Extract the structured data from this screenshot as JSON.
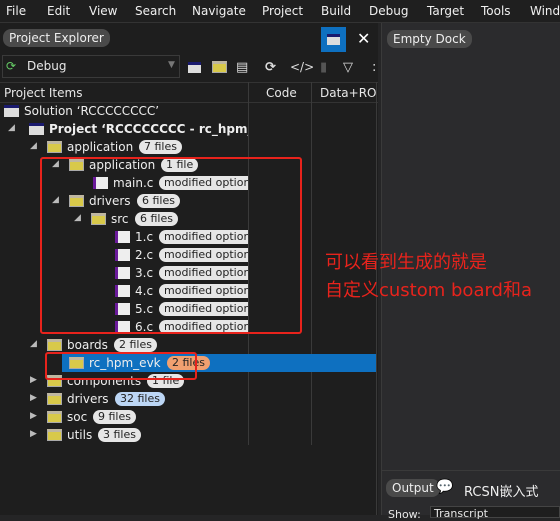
{
  "menu": [
    "File",
    "Edit",
    "View",
    "Search",
    "Navigate",
    "Project",
    "Build",
    "Debug",
    "Target",
    "Tools",
    "Window"
  ],
  "explorer": {
    "title": "Project Explorer",
    "config": "Debug"
  },
  "columns": {
    "items": "Project Items",
    "code": "Code",
    "data": "Data+RO"
  },
  "tree": [
    {
      "label": "Solution ‘RCCCCCCCC’",
      "depth": 0,
      "type": "solution",
      "arrow": ""
    },
    {
      "label": "Project ‘RCCCCCCCC - rc_hpm_evk’",
      "depth": 1,
      "type": "project",
      "arrow": "open",
      "bold": true
    },
    {
      "label": "application",
      "depth": 2,
      "type": "folder",
      "arrow": "open",
      "badge": "7 files"
    },
    {
      "label": "application",
      "depth": 3,
      "type": "folder",
      "arrow": "open",
      "badge": "1 file"
    },
    {
      "label": "main.c",
      "depth": 4,
      "type": "file",
      "badge": "modified options"
    },
    {
      "label": "drivers",
      "depth": 3,
      "type": "folder",
      "arrow": "open",
      "badge": "6 files"
    },
    {
      "label": "src",
      "depth": 4,
      "type": "folder",
      "arrow": "open",
      "badge": "6 files"
    },
    {
      "label": "1.c",
      "depth": 5,
      "type": "file",
      "badge": "modified options"
    },
    {
      "label": "2.c",
      "depth": 5,
      "type": "file",
      "badge": "modified options"
    },
    {
      "label": "3.c",
      "depth": 5,
      "type": "file",
      "badge": "modified options"
    },
    {
      "label": "4.c",
      "depth": 5,
      "type": "file",
      "badge": "modified options"
    },
    {
      "label": "5.c",
      "depth": 5,
      "type": "file",
      "badge": "modified options"
    },
    {
      "label": "6.c",
      "depth": 5,
      "type": "file",
      "badge": "modified options"
    },
    {
      "label": "boards",
      "depth": 2,
      "type": "folder",
      "arrow": "open",
      "badge": "2 files"
    },
    {
      "label": "rc_hpm_evk",
      "depth": 3,
      "type": "folder",
      "arrow": "closed",
      "badge": "2 files",
      "badge_color": "orange",
      "selected": true
    },
    {
      "label": "components",
      "depth": 2,
      "type": "folder",
      "arrow": "closed",
      "badge": "1 file"
    },
    {
      "label": "drivers",
      "depth": 2,
      "type": "folder",
      "arrow": "closed",
      "badge": "32 files",
      "badge_color": "blue"
    },
    {
      "label": "soc",
      "depth": 2,
      "type": "folder",
      "arrow": "closed",
      "badge": "9 files"
    },
    {
      "label": "utils",
      "depth": 2,
      "type": "folder",
      "arrow": "closed",
      "badge": "3 files"
    }
  ],
  "annotation": {
    "line1": "可以看到生成的就是",
    "line2": "自定义custom board和a",
    "color": "#e8231c"
  },
  "dock": {
    "title": "Empty Dock"
  },
  "output": {
    "tab": "Output",
    "watermark": "RCSN嵌入式",
    "show_label": "Show:",
    "show_value": "Transcript"
  },
  "colors": {
    "accent": "#0e70c0",
    "selection": "#0e70c0"
  }
}
